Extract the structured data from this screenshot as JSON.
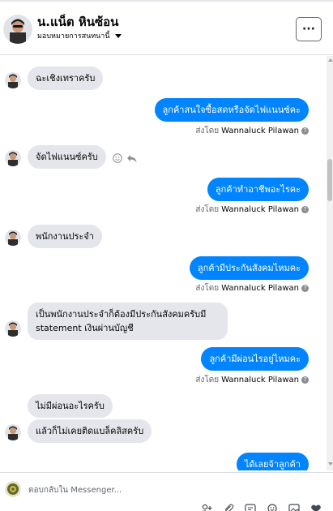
{
  "header": {
    "name": "น.แน็ต หินซ้อน",
    "assign_label": "มอบหมายการสนทนานี้",
    "more_label": "···"
  },
  "messages": [
    {
      "dir": "in",
      "text": "ฉะเชิงเทราครับ"
    },
    {
      "dir": "out",
      "text": "ลูกค้าสนใจซื้อสดหรือจัดไฟแนนซ์คะ"
    },
    {
      "dir": "in",
      "text": "จัดไฟแนนซ์ครับ"
    },
    {
      "dir": "out",
      "text": "ลูกค้าทำอาชีพอะไรคะ"
    },
    {
      "dir": "in",
      "text": "พนักงานประจำ"
    },
    {
      "dir": "out",
      "text": "ลูกค้ามีประกันสังคมไหมคะ"
    },
    {
      "dir": "in",
      "line1": "เป็นพนักงานประจำก็ต้องมีประกันสังคมครับมี",
      "line2": "statement เงินผ่านบัญชี"
    },
    {
      "dir": "out",
      "text": "ลูกค้ามีผ่อนไรอยู่ไหมคะ"
    },
    {
      "dir": "in",
      "text": "ไม่มีผ่อนอะไรครับ"
    },
    {
      "dir": "in",
      "text": "แล้วก็ไม่เคยติดแบล็คลิสครับ"
    },
    {
      "dir": "out",
      "text": "ได้เลยจ้าลูกค้า"
    }
  ],
  "sent_by": {
    "prefix": "ส่งโดย",
    "agent": "Wannaluck Pilawan",
    "help": "?"
  },
  "composer": {
    "placeholder": "ตอบกลับใน Messenger..."
  },
  "colors": {
    "outgoing_bubble": "#0084ff",
    "incoming_bubble": "#e4e6eb"
  },
  "icons": [
    "more-icon",
    "chevron-down-icon",
    "emoji-icon",
    "reply-icon",
    "help-icon",
    "add-person-icon",
    "paperclip-icon",
    "gif-icon",
    "emoji-icon",
    "image-icon",
    "like-icon"
  ]
}
